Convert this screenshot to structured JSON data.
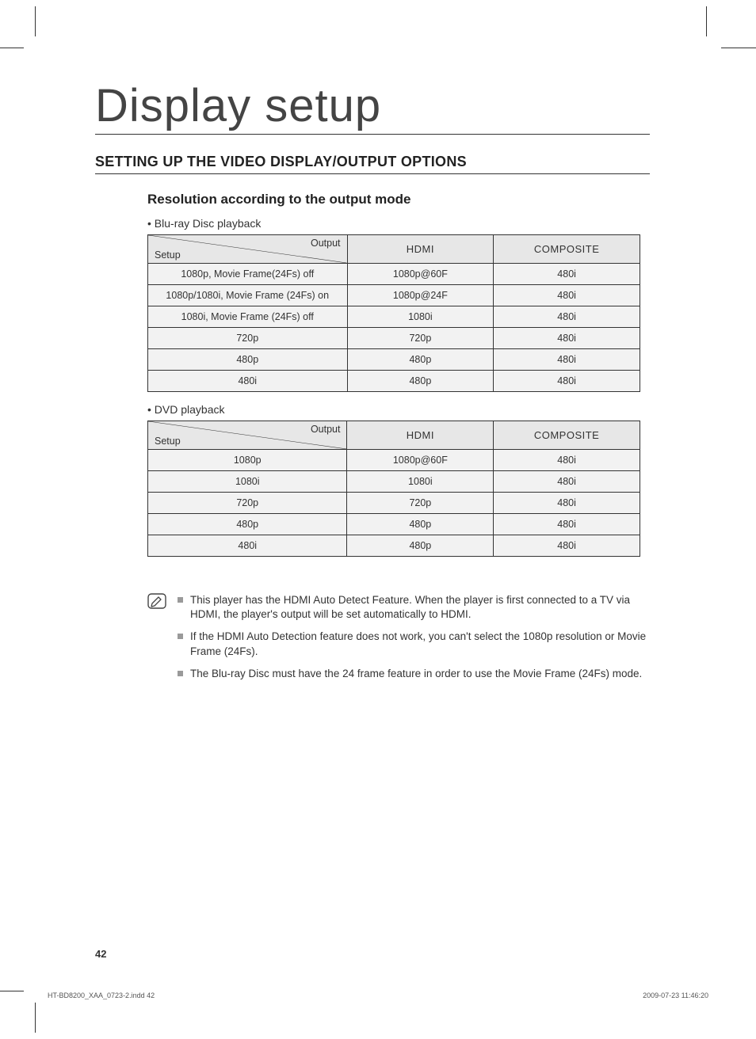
{
  "title": "Display setup",
  "section": "SETTING UP THE VIDEO DISPLAY/OUTPUT OPTIONS",
  "subheading": "Resolution according to the output mode",
  "tables": {
    "t1": {
      "caption": "• Blu-ray Disc playback",
      "corner": {
        "output": "Output",
        "setup": "Setup"
      },
      "cols": [
        "HDMI",
        "COMPOSITE"
      ],
      "rows": [
        {
          "label": "1080p, Movie Frame(24Fs) off",
          "c1": "1080p@60F",
          "c2": "480i"
        },
        {
          "label": "1080p/1080i, Movie Frame (24Fs) on",
          "c1": "1080p@24F",
          "c2": "480i"
        },
        {
          "label": "1080i, Movie Frame (24Fs) off",
          "c1": "1080i",
          "c2": "480i"
        },
        {
          "label": "720p",
          "c1": "720p",
          "c2": "480i"
        },
        {
          "label": "480p",
          "c1": "480p",
          "c2": "480i"
        },
        {
          "label": "480i",
          "c1": "480p",
          "c2": "480i"
        }
      ]
    },
    "t2": {
      "caption": "• DVD playback",
      "corner": {
        "output": "Output",
        "setup": "Setup"
      },
      "cols": [
        "HDMI",
        "COMPOSITE"
      ],
      "rows": [
        {
          "label": "1080p",
          "c1": "1080p@60F",
          "c2": "480i"
        },
        {
          "label": "1080i",
          "c1": "1080i",
          "c2": "480i"
        },
        {
          "label": "720p",
          "c1": "720p",
          "c2": "480i"
        },
        {
          "label": "480p",
          "c1": "480p",
          "c2": "480i"
        },
        {
          "label": "480i",
          "c1": "480p",
          "c2": "480i"
        }
      ]
    }
  },
  "notes": [
    "This player has the HDMI Auto Detect Feature. When the player is first connected to a TV via HDMI, the player's output will be set automatically to HDMI.",
    "If the HDMI Auto Detection feature does not work, you can't select the 1080p resolution or Movie Frame (24Fs).",
    "The Blu-ray Disc must have the 24 frame feature in order to use the Movie Frame (24Fs) mode."
  ],
  "page_number": "42",
  "footer": {
    "left": "HT-BD8200_XAA_0723-2.indd   42",
    "right": "2009-07-23     11:46:20"
  }
}
